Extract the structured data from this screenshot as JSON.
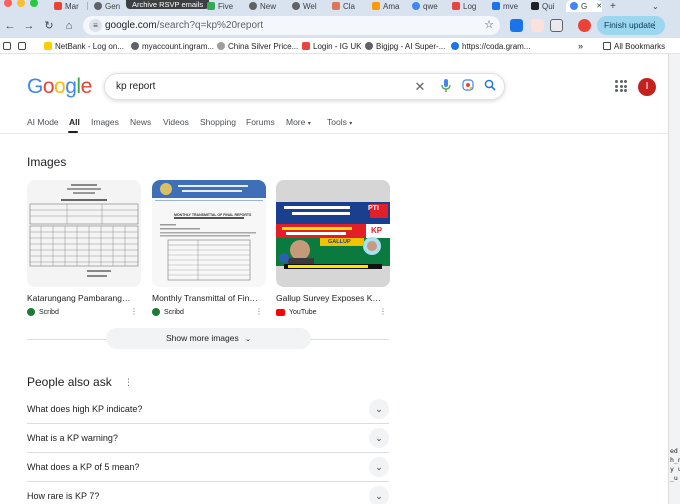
{
  "browser": {
    "tabs": [
      {
        "label": "Mar",
        "color": "#ea4335"
      },
      {
        "label": "Gen",
        "color": "#5f6368"
      },
      {
        "label": "Five",
        "color": "#34a853"
      },
      {
        "label": "New",
        "color": "#5f6368"
      },
      {
        "label": "Wel",
        "color": "#5f6368"
      },
      {
        "label": "Cla",
        "color": "#d97757"
      },
      {
        "label": "Ama",
        "color": "#ff9900"
      },
      {
        "label": "qwe",
        "color": "#4285f4"
      },
      {
        "label": "Log",
        "color": "#e8453c"
      },
      {
        "label": "mve",
        "color": "#1a73e8"
      },
      {
        "label": "Qui",
        "color": "#202124"
      },
      {
        "label": "G",
        "color": "#4285f4"
      }
    ],
    "tooltip": "Archive RSVP emails",
    "new_tab": "+",
    "url_domain": "google.com",
    "url_path": "/search?q=kp%20report",
    "finish_update": "Finish update",
    "bookmarks": [
      {
        "label": "NetBank - Log on...",
        "color": "#ffcc00"
      },
      {
        "label": "myaccount.ingram...",
        "color": "#5f6368"
      },
      {
        "label": "China Silver Price...",
        "color": "#9e9e9e"
      },
      {
        "label": "Login - IG UK",
        "color": "#e8453c"
      },
      {
        "label": "Bigjpg - AI Super-...",
        "color": "#5f6368"
      },
      {
        "label": "https://coda.gram...",
        "color": "#1a73e8"
      }
    ],
    "all_bookmarks": "All Bookmarks"
  },
  "search": {
    "logo": "Google",
    "query": "kp report",
    "avatar_letter": "I",
    "filters": [
      "AI Mode",
      "All",
      "Images",
      "News",
      "Videos",
      "Shopping",
      "Forums",
      "More",
      "Tools"
    ],
    "active_filter": "All"
  },
  "images": {
    "heading": "Images",
    "cards": [
      {
        "title": "Katarungang Pambarangay C...",
        "source": "Scribd",
        "source_color": "#1e7b34"
      },
      {
        "title": "Monthly Transmittal of Final R...",
        "source": "Scribd",
        "source_color": "#1e7b34"
      },
      {
        "title": "Gallup Survey Exposes KP G...",
        "source": "YouTube",
        "source_color": "#ff0000"
      }
    ],
    "thumb2_heading": "MONTHLY TRANSMITTAL OF FINAL REPORTS",
    "thumb3_text": "PTI",
    "thumb3_text2": "KP",
    "thumb3_text3": "GALLUP",
    "show_more": "Show more images"
  },
  "paa": {
    "heading": "People also ask",
    "questions": [
      "What does high KP indicate?",
      "What is a KP warning?",
      "What does a KP of 5 mean?",
      "How rare is KP 7?"
    ]
  },
  "peek_code": "ed\nh_n\ny u\n_u"
}
